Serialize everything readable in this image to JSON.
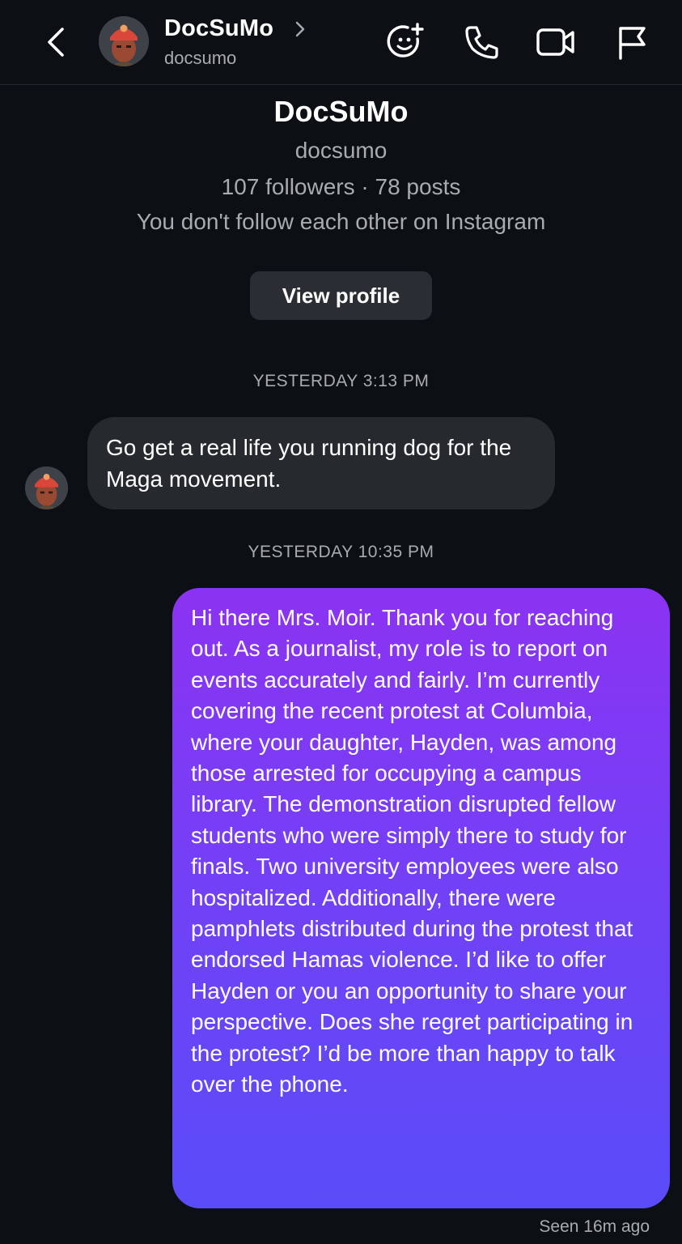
{
  "header": {
    "display_name": "DocSuMo",
    "username": "docsumo",
    "icons": {
      "back": "chevron-left-icon",
      "profile_arrow": "chevron-right-icon",
      "sticker": "sticker-add-icon",
      "call": "phone-icon",
      "video": "video-camera-icon",
      "report": "flag-icon"
    }
  },
  "profile_card": {
    "display_name": "DocSuMo",
    "username": "docsumo",
    "stats": "107 followers · 78 posts",
    "follow_status": "You don't follow each other on Instagram",
    "view_profile_label": "View profile"
  },
  "messages": [
    {
      "timestamp": "YESTERDAY 3:13 PM",
      "direction": "incoming",
      "text": "Go get a real life you running dog for the Maga movement."
    },
    {
      "timestamp": "YESTERDAY 10:35 PM",
      "direction": "outgoing",
      "text": "Hi there Mrs. Moir. Thank you for reaching out. As a journalist, my role is to report on events accurately and fairly. I’m currently covering the recent protest at Columbia, where your daughter, Hayden, was among those arrested for occupying a campus library. The demonstration disrupted fellow students who were simply there to study for finals. Two university employees were also hospitalized. Additionally, there were pamphlets distributed during the protest that endorsed Hamas violence. I’d like to offer Hayden or you an opportunity to share your perspective. Does she regret participating in the protest? I’d be more than happy to talk over the phone."
    }
  ],
  "seen_status": "Seen 16m ago",
  "colors": {
    "background": "#0c0f14",
    "incoming_bubble": "#26292e",
    "outgoing_gradient_top": "#8b33f2",
    "outgoing_gradient_bottom": "#5a4cf8",
    "secondary_text": "#a8abb0"
  }
}
